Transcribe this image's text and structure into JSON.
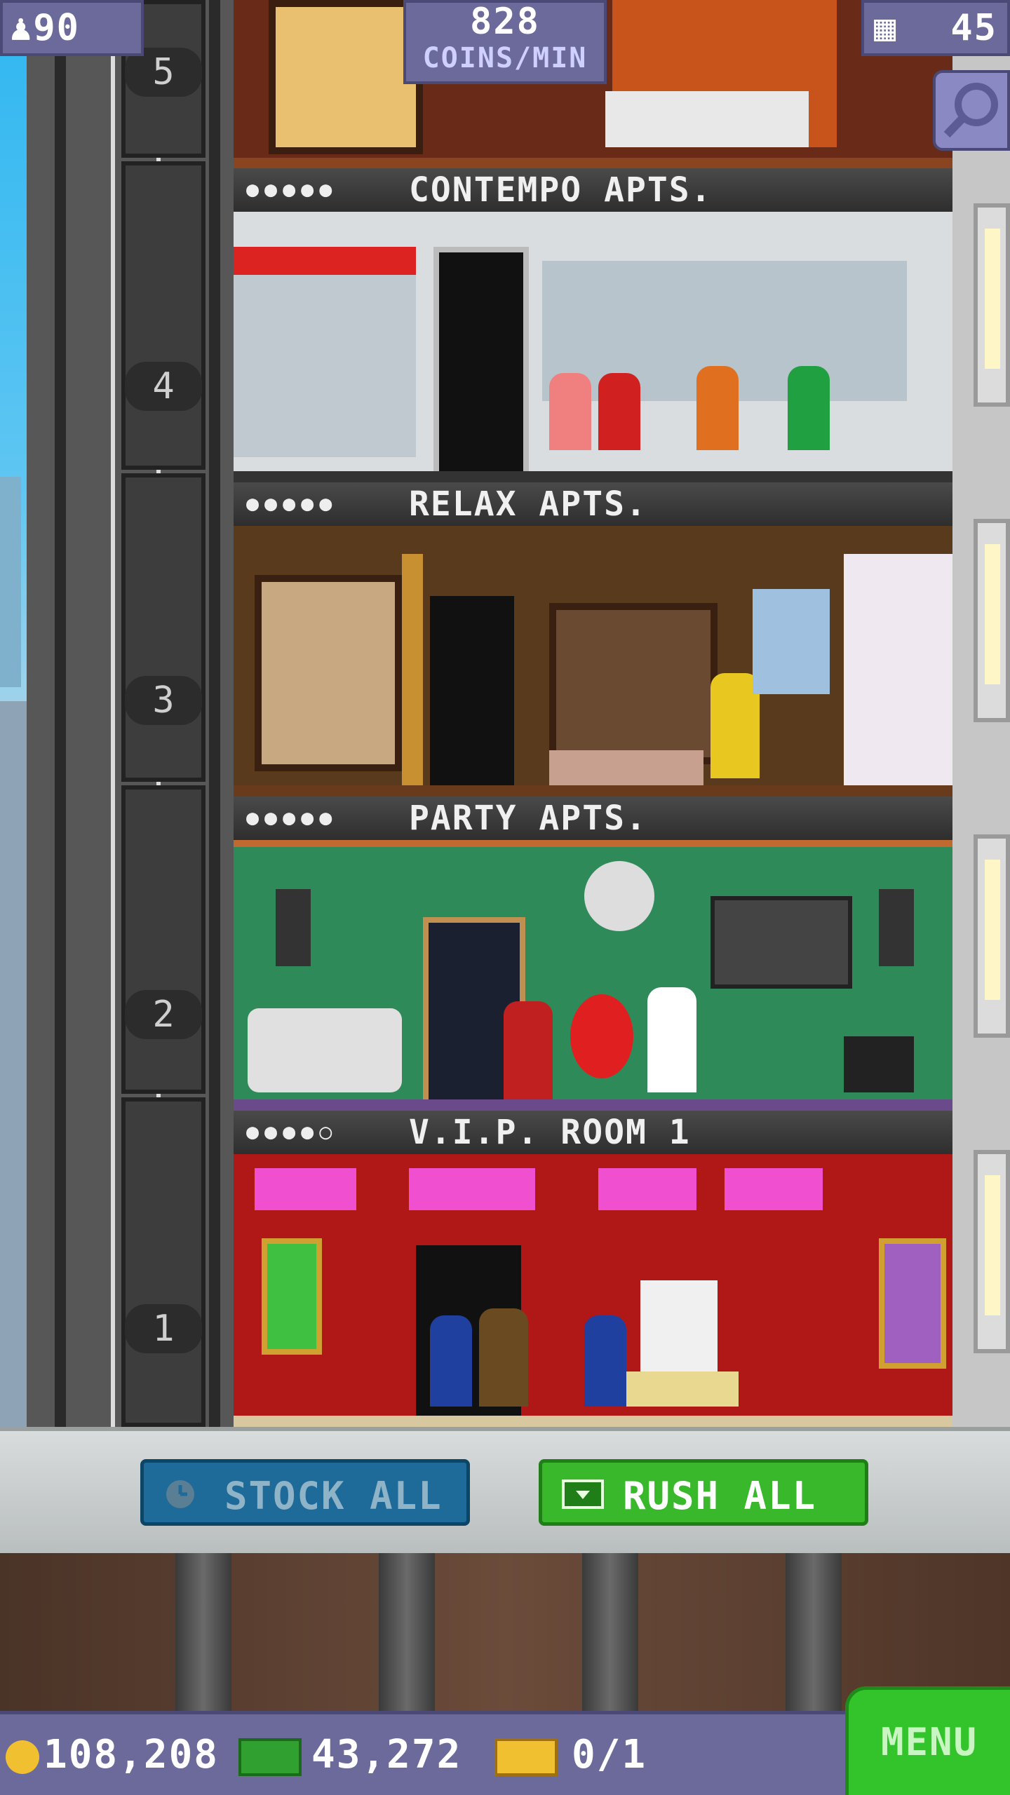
{
  "hud": {
    "population": "90",
    "coins_per_min_value": "828",
    "coins_per_min_unit": "COINS/MIN",
    "floor_count": "45"
  },
  "elevator": {
    "floor_numbers": [
      "5",
      "4",
      "3",
      "2",
      "1"
    ]
  },
  "floors": [
    {
      "name": "CONTEMPO APTS.",
      "residents": "●●●●●"
    },
    {
      "name": "RELAX APTS.",
      "residents": "●●●●●"
    },
    {
      "name": "PARTY APTS.",
      "residents": "●●●●●"
    },
    {
      "name": "V.I.P. ROOM 1",
      "residents": "●●●●○"
    }
  ],
  "actions": {
    "stock_all": "STOCK ALL",
    "rush_all": "RUSH ALL"
  },
  "bottom": {
    "coins": "108,208",
    "bux": "43,272",
    "tickets": "0/1",
    "menu": "MENU"
  },
  "colors": {
    "hud_bg": "#6c6a9a",
    "rush_green": "#38b82a",
    "stock_blue": "#1e6a98",
    "vip_red": "#b01818",
    "party_green": "#2f8a5a"
  }
}
